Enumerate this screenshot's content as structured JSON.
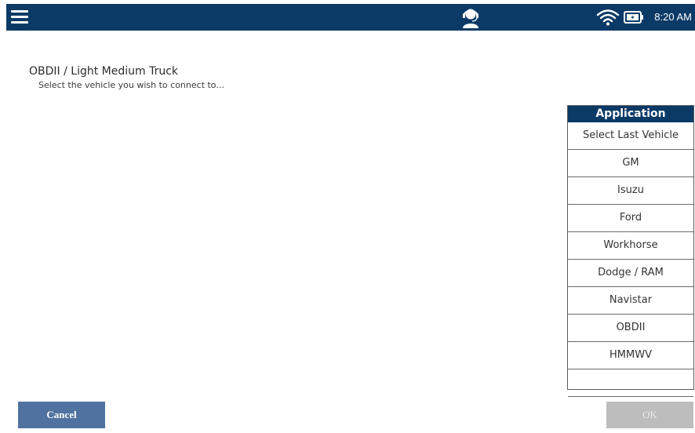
{
  "status_bar": {
    "time": "8:20 AM",
    "icons": [
      "menu-icon",
      "support-agent-icon",
      "wifi-icon",
      "battery-charging-icon"
    ],
    "colors": {
      "bar": "#0c3a67",
      "icon": "#ffffff"
    }
  },
  "header": {
    "title": "OBDII / Light Medium Truck",
    "subtitle": "Select the vehicle you wish to connect to..."
  },
  "application_list": {
    "heading": "Application",
    "items": [
      "Select Last Vehicle",
      "GM",
      "Isuzu",
      "Ford",
      "Workhorse",
      "Dodge / RAM",
      "Navistar",
      "OBDII",
      "HMMWV",
      ""
    ]
  },
  "footer": {
    "cancel_label": "Cancel",
    "ok_label": "OK",
    "colors": {
      "cancel": "#5072a0",
      "ok_disabled": "#bdbdbd"
    }
  }
}
